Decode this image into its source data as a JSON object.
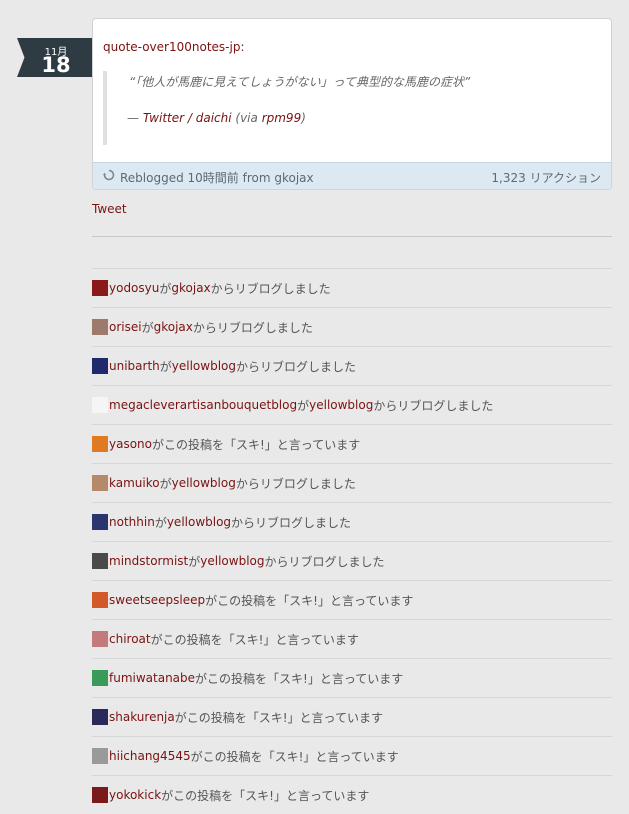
{
  "date": {
    "month": "11月",
    "day": "18"
  },
  "post": {
    "source_label": "quote-over100notes-jp:",
    "quote_text": "“「他人が馬鹿に見えてしょうがない」って典型的な馬鹿の症状”",
    "attrib_prefix": "— ",
    "attrib_link": "Twitter / daichi",
    "attrib_via_open": " (via ",
    "attrib_via_link": "rpm99",
    "attrib_via_close": ")",
    "reblogged_text": "Reblogged 10時間前 from ",
    "reblogged_from": "gkojax",
    "notes_count": "1,323 リアクション"
  },
  "tweet_label": "Tweet",
  "notes": [
    {
      "user": "yodosyu",
      "mid": "が",
      "from": "gkojax",
      "tail": "からリブログしました",
      "avatar_color": "#8a1a1a"
    },
    {
      "user": "orisei",
      "mid": "が",
      "from": "gkojax",
      "tail": "からリブログしました",
      "avatar_color": "#9c7b6c"
    },
    {
      "user": "unibarth",
      "mid": "が",
      "from": "yellowblog",
      "tail": "からリブログしました",
      "avatar_color": "#1e2a6b"
    },
    {
      "user": "megacleverartisanbouquetblog",
      "mid": "が",
      "from": "yellowblog",
      "tail": "からリブログしました",
      "avatar_color": "#f5f5f5"
    },
    {
      "user": "yasono",
      "mid": "がこの投稿を「スキ!」と言っています",
      "from": "",
      "tail": "",
      "avatar_color": "#e07a22"
    },
    {
      "user": "kamuiko",
      "mid": "が",
      "from": "yellowblog",
      "tail": "からリブログしました",
      "avatar_color": "#b58a6a"
    },
    {
      "user": "nothhin",
      "mid": "が",
      "from": "yellowblog",
      "tail": "からリブログしました",
      "avatar_color": "#2a3570"
    },
    {
      "user": "mindstormist",
      "mid": "が",
      "from": "yellowblog",
      "tail": "からリブログしました",
      "avatar_color": "#4a4a4a"
    },
    {
      "user": "sweetseepsleep",
      "mid": "がこの投稿を「スキ!」と言っています",
      "from": "",
      "tail": "",
      "avatar_color": "#d25a2a"
    },
    {
      "user": "chiroat",
      "mid": "がこの投稿を「スキ!」と言っています",
      "from": "",
      "tail": "",
      "avatar_color": "#c47a7a"
    },
    {
      "user": "fumiwatanabe",
      "mid": "がこの投稿を「スキ!」と言っています",
      "from": "",
      "tail": "",
      "avatar_color": "#3a9a5a"
    },
    {
      "user": "shakurenja",
      "mid": "がこの投稿を「スキ!」と言っています",
      "from": "",
      "tail": "",
      "avatar_color": "#2a2a5a"
    },
    {
      "user": "hiichang4545",
      "mid": "がこの投稿を「スキ!」と言っています",
      "from": "",
      "tail": "",
      "avatar_color": "#9a9a9a"
    },
    {
      "user": "yokokick",
      "mid": "がこの投稿を「スキ!」と言っています",
      "from": "",
      "tail": "",
      "avatar_color": "#7a1a1a"
    }
  ]
}
